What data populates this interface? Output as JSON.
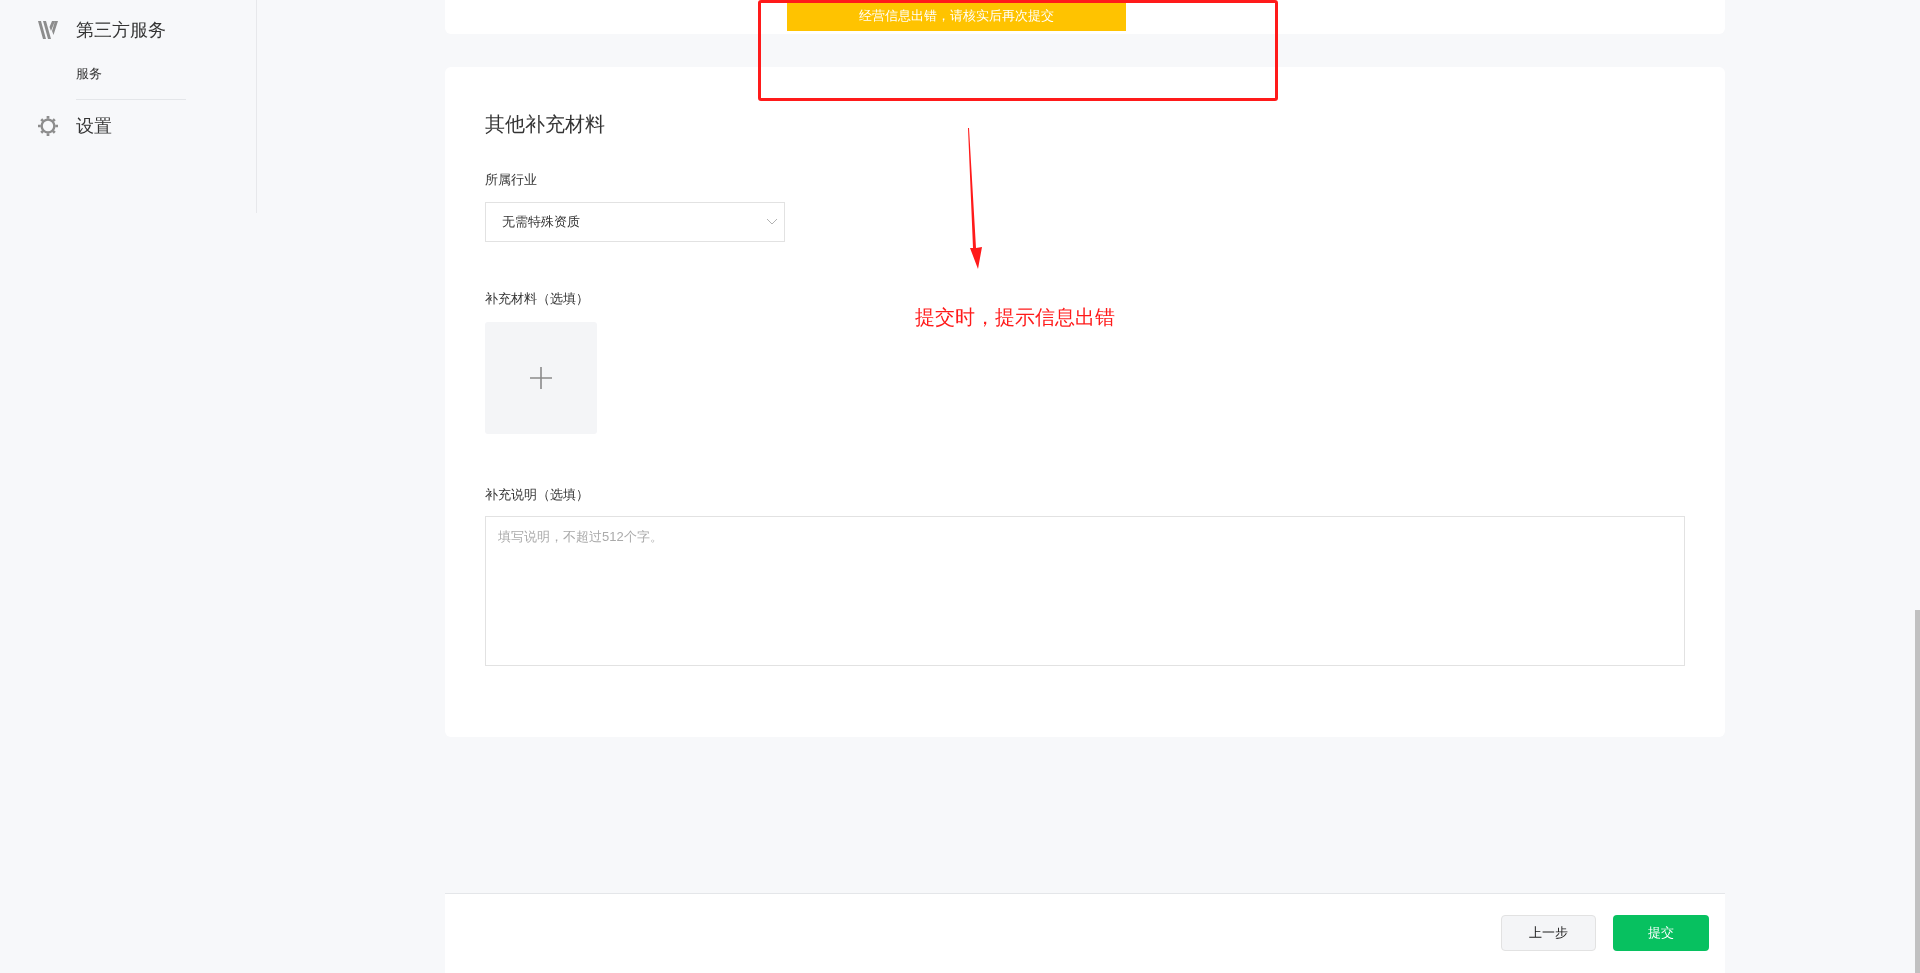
{
  "sidebar": {
    "items": [
      {
        "kind": "logo",
        "label": "第三方服务",
        "children": [
          {
            "label": "服务"
          }
        ]
      },
      {
        "kind": "gear",
        "label": "设置"
      }
    ]
  },
  "toast": {
    "message": "经营信息出错，请核实后再次提交"
  },
  "section": {
    "title": "其他补充材料",
    "industry": {
      "label": "所属行业",
      "value": "无需特殊资质"
    },
    "materials": {
      "label": "补充材料（选填）"
    },
    "notes": {
      "label": "补充说明（选填）",
      "placeholder": "填写说明，不超过512个字。"
    }
  },
  "footer": {
    "buttons": [
      {
        "kind": "secondary",
        "label": "上一步"
      },
      {
        "kind": "primary",
        "label": "提交"
      }
    ]
  },
  "annotation": {
    "note": "提交时，提示信息出错"
  }
}
